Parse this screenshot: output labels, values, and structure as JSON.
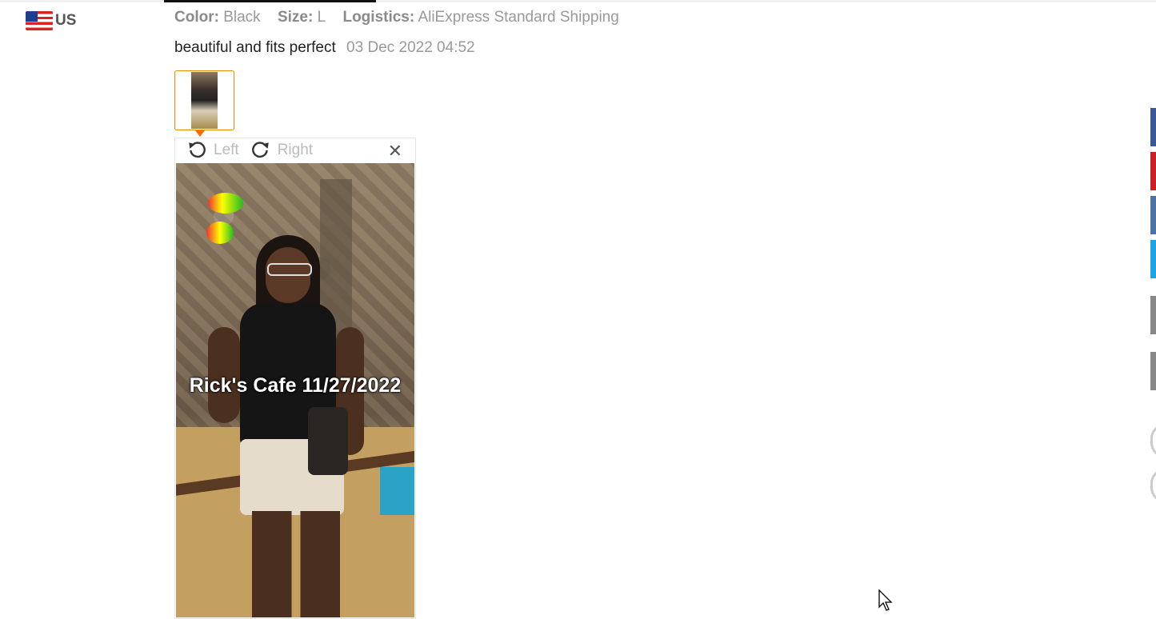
{
  "reviewer": {
    "country_code": "US"
  },
  "meta": {
    "color_label": "Color:",
    "color_value": "Black",
    "size_label": "Size:",
    "size_value": "L",
    "logistics_label": "Logistics:",
    "logistics_value": "AliExpress Standard Shipping"
  },
  "review": {
    "text": "beautiful and fits perfect",
    "date": "03 Dec 2022 04:52"
  },
  "viewer": {
    "rotate_left_label": "Left",
    "rotate_right_label": "Right",
    "close_symbol": "✕",
    "photo_caption": "Rick's Cafe 11/27/2022"
  },
  "icons": [
    "flag-us-icon",
    "rotate-left-icon",
    "rotate-right-icon",
    "close-icon",
    "mouse-cursor-icon"
  ],
  "colors": {
    "accent": "#ff6a00",
    "thumb_border": "#e88a00",
    "facebook": "#3b5998",
    "pinterest": "#cb2027",
    "vk": "#4d73a5",
    "twitter": "#1ca4e4"
  }
}
